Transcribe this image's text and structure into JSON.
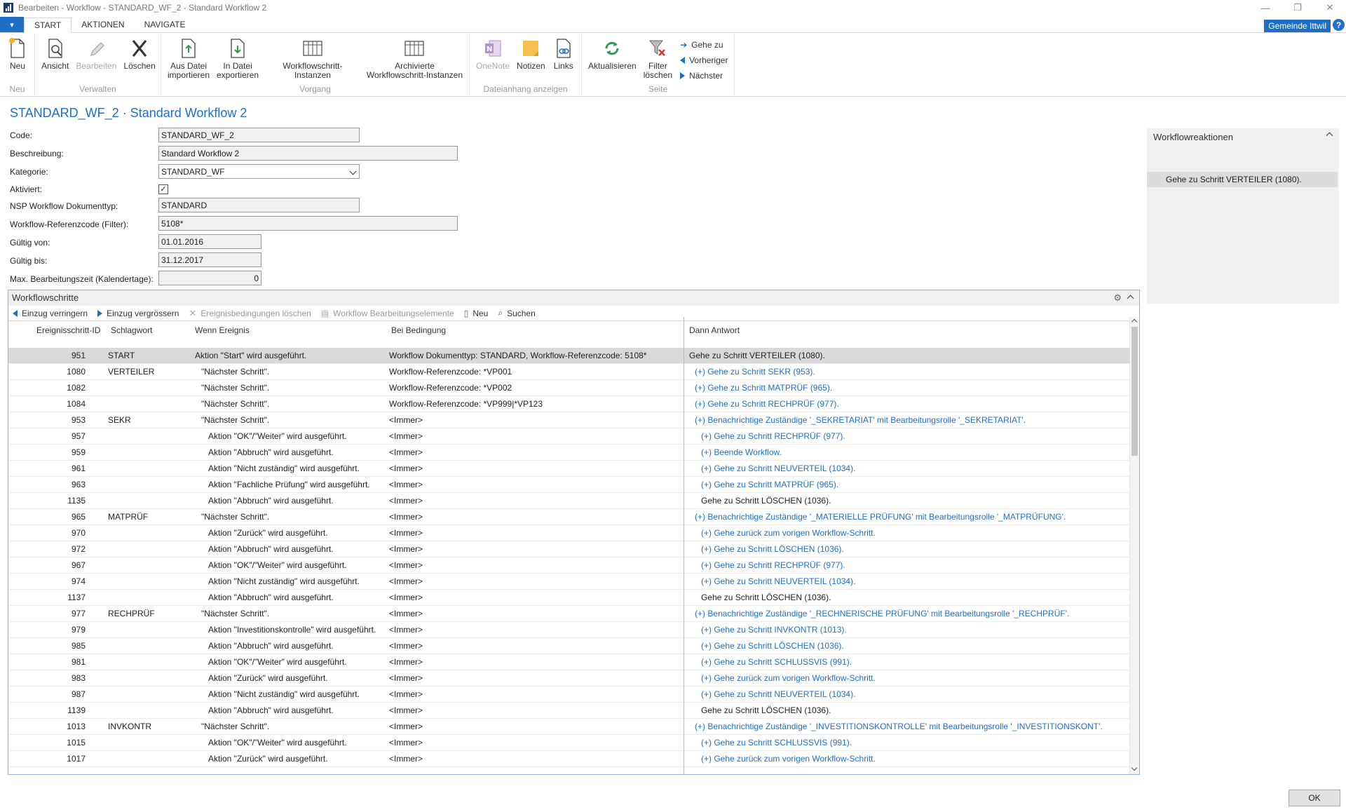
{
  "window": {
    "title": "Bearbeiten - Workflow - STANDARD_WF_2 - Standard Workflow 2",
    "controls": [
      "—",
      "❐",
      "✕"
    ]
  },
  "ribbon": {
    "tabs": [
      "START",
      "AKTIONEN",
      "NAVIGATE"
    ],
    "company": "Gemeinde Ittwil",
    "help": "?",
    "groups": {
      "neu": {
        "label": "Neu",
        "buttons": [
          "Neu"
        ]
      },
      "verwalten": {
        "label": "Verwalten",
        "buttons": [
          "Ansicht",
          "Bearbeiten",
          "Löschen"
        ]
      },
      "vorgang": {
        "label": "Vorgang",
        "buttons": [
          "Aus Datei\nimportieren",
          "In Datei\nexportieren",
          "Workflowschritt-Instanzen",
          "Archivierte\nWorkflowschritt-Instanzen"
        ]
      },
      "dateianhang": {
        "label": "Dateianhang anzeigen",
        "buttons": [
          "OneNote",
          "Notizen",
          "Links"
        ]
      },
      "seite": {
        "label": "Seite",
        "buttons": [
          "Aktualisieren",
          "Filter\nlöschen"
        ],
        "nav": [
          "Gehe zu",
          "Vorheriger",
          "Nächster"
        ]
      }
    }
  },
  "page": {
    "title": "STANDARD_WF_2 · Standard Workflow 2"
  },
  "form": {
    "code": {
      "label": "Code:",
      "value": "STANDARD_WF_2"
    },
    "beschreibung": {
      "label": "Beschreibung:",
      "value": "Standard Workflow 2"
    },
    "kategorie": {
      "label": "Kategorie:",
      "value": "STANDARD_WF"
    },
    "aktiviert": {
      "label": "Aktiviert:",
      "value": "✓"
    },
    "doktyp": {
      "label": "NSP Workflow Dokumenttyp:",
      "value": "STANDARD"
    },
    "refcode": {
      "label": "Workflow-Referenzcode (Filter):",
      "value": "5108*"
    },
    "gueltig_von": {
      "label": "Gültig von:",
      "value": "01.01.2016"
    },
    "gueltig_bis": {
      "label": "Gültig bis:",
      "value": "31.12.2017"
    },
    "max_zeit": {
      "label": "Max. Bearbeitungszeit (Kalendertage):",
      "value": "0"
    }
  },
  "factbox": {
    "title": "Workflowreaktionen",
    "row": "Gehe zu Schritt VERTEILER (1080)."
  },
  "subpage": {
    "title": "Workflowschritte",
    "actions": {
      "einzug_verringern": "Einzug verringern",
      "einzug_vergroessern": "Einzug vergrössern",
      "ereignis_loeschen": "Ereignisbedingungen löschen",
      "bearbeitungselemente": "Workflow Bearbeitungselemente",
      "neu": "Neu",
      "suchen": "Suchen"
    },
    "columns": [
      "Ereignisschritt-ID",
      "Schlagwort",
      "Wenn Ereignis",
      "Bei Bedingung",
      "Dann Antwort"
    ],
    "rows": [
      {
        "id": "951",
        "kw": "START",
        "ev": "Aktion \"Start\" wird ausgeführt.",
        "cond": "Workflow Dokumenttyp: STANDARD, Workflow-Referenzcode: 5108*",
        "resp": "Gehe zu Schritt VERTEILER (1080).",
        "ind": 0,
        "link": false,
        "sel": true
      },
      {
        "id": "1080",
        "kw": "VERTEILER",
        "ev": "\"Nächster Schritt\".",
        "cond": "Workflow-Referenzcode: *VP001",
        "resp": "(+) Gehe zu Schritt SEKR (953).",
        "ind": 1,
        "link": true
      },
      {
        "id": "1082",
        "kw": "",
        "ev": "\"Nächster Schritt\".",
        "cond": "Workflow-Referenzcode: *VP002",
        "resp": "(+) Gehe zu Schritt MATPRÜF (965).",
        "ind": 1,
        "link": true
      },
      {
        "id": "1084",
        "kw": "",
        "ev": "\"Nächster Schritt\".",
        "cond": "Workflow-Referenzcode: *VP999|*VP123",
        "resp": "(+) Gehe zu Schritt RECHPRÜF (977).",
        "ind": 1,
        "link": true
      },
      {
        "id": "953",
        "kw": "SEKR",
        "ev": "\"Nächster Schritt\".",
        "cond": "<Immer>",
        "resp": "(+) Benachrichtige Zuständige '_SEKRETARIAT' mit Bearbeitungsrolle '_SEKRETARIAT'.",
        "ind": 1,
        "link": true
      },
      {
        "id": "957",
        "kw": "",
        "ev": "Aktion \"OK\"/\"Weiter\" wird ausgeführt.",
        "cond": "<Immer>",
        "resp": "(+) Gehe zu Schritt RECHPRÜF (977).",
        "ind": 2,
        "link": true
      },
      {
        "id": "959",
        "kw": "",
        "ev": "Aktion \"Abbruch\" wird ausgeführt.",
        "cond": "<Immer>",
        "resp": "(+) Beende Workflow.",
        "ind": 2,
        "link": true
      },
      {
        "id": "961",
        "kw": "",
        "ev": "Aktion \"Nicht zuständig\" wird ausgeführt.",
        "cond": "<Immer>",
        "resp": "(+) Gehe zu Schritt NEUVERTEIL (1034).",
        "ind": 2,
        "link": true
      },
      {
        "id": "963",
        "kw": "",
        "ev": "Aktion \"Fachliche Prüfung\" wird ausgeführt.",
        "cond": "<Immer>",
        "resp": "(+) Gehe zu Schritt MATPRÜF (965).",
        "ind": 2,
        "link": true
      },
      {
        "id": "1135",
        "kw": "",
        "ev": "Aktion \"Abbruch\" wird ausgeführt.",
        "cond": "<Immer>",
        "resp": "Gehe zu Schritt LÖSCHEN (1036).",
        "ind": 2,
        "link": false
      },
      {
        "id": "965",
        "kw": "MATPRÜF",
        "ev": "\"Nächster Schritt\".",
        "cond": "<Immer>",
        "resp": "(+) Benachrichtige Zuständige '_MATERIELLE PRÜFUNG' mit Bearbeitungsrolle '_MATPRÜFUNG'.",
        "ind": 1,
        "link": true
      },
      {
        "id": "970",
        "kw": "",
        "ev": "Aktion \"Zurück\" wird ausgeführt.",
        "cond": "<Immer>",
        "resp": "(+) Gehe zurück zum vorigen Workflow-Schritt.",
        "ind": 2,
        "link": true
      },
      {
        "id": "972",
        "kw": "",
        "ev": "Aktion \"Abbruch\" wird ausgeführt.",
        "cond": "<Immer>",
        "resp": "(+) Gehe zu Schritt LÖSCHEN (1036).",
        "ind": 2,
        "link": true
      },
      {
        "id": "967",
        "kw": "",
        "ev": "Aktion \"OK\"/\"Weiter\" wird ausgeführt.",
        "cond": "<Immer>",
        "resp": "(+) Gehe zu Schritt RECHPRÜF (977).",
        "ind": 2,
        "link": true
      },
      {
        "id": "974",
        "kw": "",
        "ev": "Aktion \"Nicht zuständig\" wird ausgeführt.",
        "cond": "<Immer>",
        "resp": "(+) Gehe zu Schritt NEUVERTEIL (1034).",
        "ind": 2,
        "link": true
      },
      {
        "id": "1137",
        "kw": "",
        "ev": "Aktion \"Abbruch\" wird ausgeführt.",
        "cond": "<Immer>",
        "resp": "Gehe zu Schritt LÖSCHEN (1036).",
        "ind": 2,
        "link": false
      },
      {
        "id": "977",
        "kw": "RECHPRÜF",
        "ev": "\"Nächster Schritt\".",
        "cond": "<Immer>",
        "resp": "(+) Benachrichtige Zuständige '_RECHNERISCHE PRÜFUNG' mit Bearbeitungsrolle '_RECHPRÜF'.",
        "ind": 1,
        "link": true
      },
      {
        "id": "979",
        "kw": "",
        "ev": "Aktion \"Investitionskontrolle\" wird ausgeführt.",
        "cond": "<Immer>",
        "resp": "(+) Gehe zu Schritt INVKONTR (1013).",
        "ind": 2,
        "link": true
      },
      {
        "id": "985",
        "kw": "",
        "ev": "Aktion \"Abbruch\" wird ausgeführt.",
        "cond": "<Immer>",
        "resp": "(+) Gehe zu Schritt LÖSCHEN (1036).",
        "ind": 2,
        "link": true
      },
      {
        "id": "981",
        "kw": "",
        "ev": "Aktion \"OK\"/\"Weiter\" wird ausgeführt.",
        "cond": "<Immer>",
        "resp": "(+) Gehe zu Schritt SCHLUSSVIS (991).",
        "ind": 2,
        "link": true
      },
      {
        "id": "983",
        "kw": "",
        "ev": "Aktion \"Zurück\" wird ausgeführt.",
        "cond": "<Immer>",
        "resp": "(+) Gehe zurück zum vorigen Workflow-Schritt.",
        "ind": 2,
        "link": true
      },
      {
        "id": "987",
        "kw": "",
        "ev": "Aktion \"Nicht zuständig\" wird ausgeführt.",
        "cond": "<Immer>",
        "resp": "(+) Gehe zu Schritt NEUVERTEIL (1034).",
        "ind": 2,
        "link": true
      },
      {
        "id": "1139",
        "kw": "",
        "ev": "Aktion \"Abbruch\" wird ausgeführt.",
        "cond": "<Immer>",
        "resp": "Gehe zu Schritt LÖSCHEN (1036).",
        "ind": 2,
        "link": false
      },
      {
        "id": "1013",
        "kw": "INVKONTR",
        "ev": "\"Nächster Schritt\".",
        "cond": "<Immer>",
        "resp": "(+) Benachrichtige Zuständige '_INVESTITIONSKONTROLLE' mit Bearbeitungsrolle '_INVESTITIONSKONT'.",
        "ind": 1,
        "link": true
      },
      {
        "id": "1015",
        "kw": "",
        "ev": "Aktion \"OK\"/\"Weiter\" wird ausgeführt.",
        "cond": "<Immer>",
        "resp": "(+) Gehe zu Schritt SCHLUSSVIS (991).",
        "ind": 2,
        "link": true
      },
      {
        "id": "1017",
        "kw": "",
        "ev": "Aktion \"Zurück\" wird ausgeführt.",
        "cond": "<Immer>",
        "resp": "(+) Gehe zurück zum vorigen Workflow-Schritt.",
        "ind": 2,
        "link": true
      }
    ]
  },
  "footer": {
    "ok": "OK"
  },
  "colors": {
    "accent": "#1f6fc5",
    "selected_row": "#d9d9d9",
    "factbox_bg": "#f0f0f0"
  }
}
